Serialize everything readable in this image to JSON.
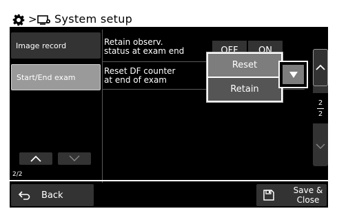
{
  "header": {
    "breadcrumb_sep": ">",
    "title": "System setup",
    "icons": [
      "gear-icon",
      "monitor-settings-icon"
    ]
  },
  "sidebar": {
    "items": [
      {
        "label": "Image record",
        "selected": false
      },
      {
        "label": "Start/End exam",
        "selected": true
      }
    ],
    "page": "2/2"
  },
  "settings": {
    "retain_label": "Retain observ.\nstatus at exam end",
    "retain_off": "OFF",
    "retain_on": "ON",
    "reset_label": "Reset DF counter\nat end of exam",
    "dropdown": {
      "options": [
        "Reset",
        "Retain"
      ],
      "highlighted": "Retain"
    }
  },
  "scroller": {
    "page_current": "2",
    "page_total": "2"
  },
  "footer": {
    "back_label": "Back",
    "save_label": "Save &\nClose"
  },
  "colors": {
    "background": "#000000",
    "button": "#333333",
    "selected": "#9a9a9a",
    "dropdown_option": "#7d7d7d",
    "text": "#ffffff"
  }
}
